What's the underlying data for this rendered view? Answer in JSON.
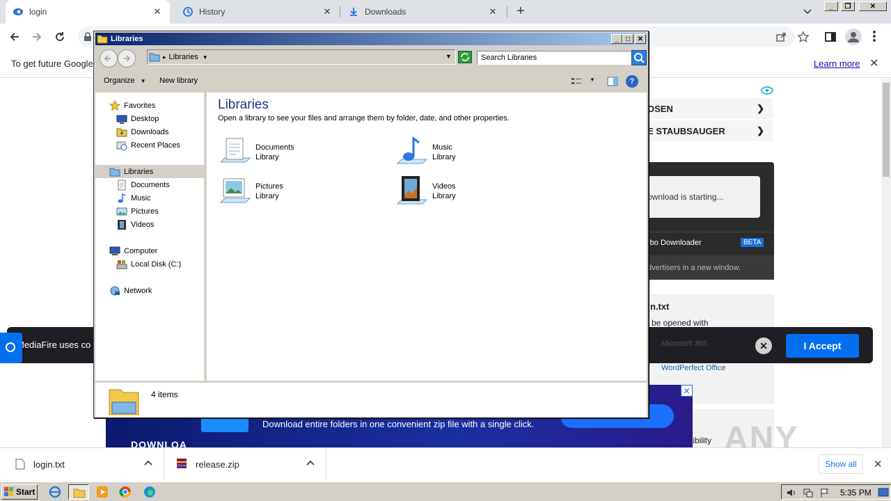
{
  "browser": {
    "tabs": [
      {
        "label": "login",
        "icon": "mediafire-icon"
      },
      {
        "label": "History",
        "icon": "history-icon"
      },
      {
        "label": "Downloads",
        "icon": "download-icon"
      }
    ],
    "new_tab": "+",
    "infobar": {
      "text": "To get future Google",
      "learn_more": "Learn more"
    }
  },
  "page": {
    "ad_rows": [
      "OSEN",
      "E STAUBSAUGER"
    ],
    "download_box": {
      "status": "ownload is starting...",
      "downloader_label": "rbo Downloader",
      "beta": "BETA",
      "advertisers": "dvertisers in a new window."
    },
    "file_panel": {
      "filename": "n.txt",
      "opened_with": "be opened with",
      "app1": "Microsoft 365",
      "app2": "WordPerfect Office",
      "compat": "tibility"
    },
    "cookie_bar": {
      "text": "MediaFire uses co",
      "accept": "I Accept"
    },
    "banner": {
      "text": "Download entire folders in one convenient zip file with a single click.",
      "logo_text": "DOWNLOA"
    }
  },
  "shelf": {
    "items": [
      {
        "name": "login.txt"
      },
      {
        "name": "release.zip"
      }
    ],
    "show_all": "Show all"
  },
  "taskbar": {
    "start": "Start",
    "clock": "5:35 PM"
  },
  "explorer": {
    "title": "Libraries",
    "address": "Libraries",
    "search_placeholder": "Search Libraries",
    "organize": "Organize",
    "new_library": "New library",
    "nav": {
      "favorites": "Favorites",
      "desktop": "Desktop",
      "downloads": "Downloads",
      "recent": "Recent Places",
      "libraries": "Libraries",
      "documents": "Documents",
      "music": "Music",
      "pictures": "Pictures",
      "videos": "Videos",
      "computer": "Computer",
      "local_disk": "Local Disk (C:)",
      "network": "Network"
    },
    "heading": "Libraries",
    "description": "Open a library to see your files and arrange them by folder, date, and other properties.",
    "libraries": [
      {
        "name": "Documents",
        "sub": "Library"
      },
      {
        "name": "Music",
        "sub": "Library"
      },
      {
        "name": "Pictures",
        "sub": "Library"
      },
      {
        "name": "Videos",
        "sub": "Library"
      }
    ],
    "item_count": "4 items"
  },
  "watermark": "ANY RUN",
  "colors": {
    "accent": "#0070f0",
    "title_start": "#0a246a",
    "title_end": "#a6caf0"
  }
}
